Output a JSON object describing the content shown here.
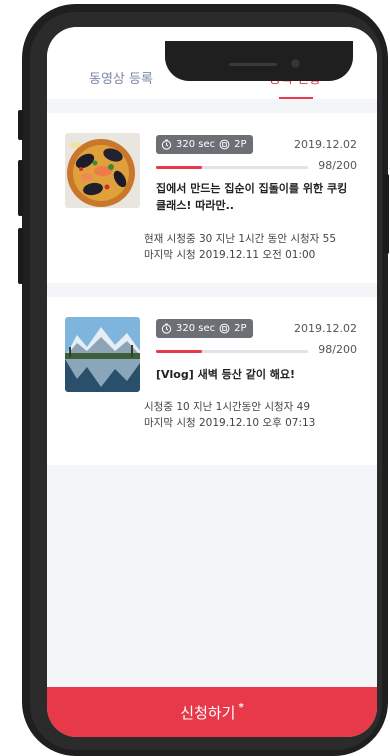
{
  "tabs": {
    "upload_label": "동영상 등록",
    "status_label": "등록 현황",
    "status_marker": "+"
  },
  "items": [
    {
      "duration": "320 sec",
      "parts": "2P",
      "date": "2019.12.02",
      "progress": "98/200",
      "progress_fraction": 0.3,
      "title": "집에서 만드는 집순이 집돌이를 위한 쿠킹 클래스! 따라만..",
      "meta_line1": "현재 시청중 30 지난 1시간 동안 시청자 55",
      "meta_line2": "마지막 시청 2019.12.11 오전 01:00",
      "thumbnail_icon": "paella-food-photo"
    },
    {
      "duration": "320 sec",
      "parts": "2P",
      "date": "2019.12.02",
      "progress": "98/200",
      "progress_fraction": 0.3,
      "title": "[Vlog] 새벽 등산 같이 해요!",
      "meta_line1": "시청중 10 지난 1시간동안 시청자 49",
      "meta_line2": "마지막 시청 2019.12.10 오후 07:13",
      "thumbnail_icon": "mountain-lake-photo"
    }
  ],
  "apply_button": {
    "label": "신청하기",
    "marker": "*"
  },
  "colors": {
    "accent": "#e8394b",
    "badge": "#6d6f76",
    "tab_inactive": "#7c87a8"
  }
}
